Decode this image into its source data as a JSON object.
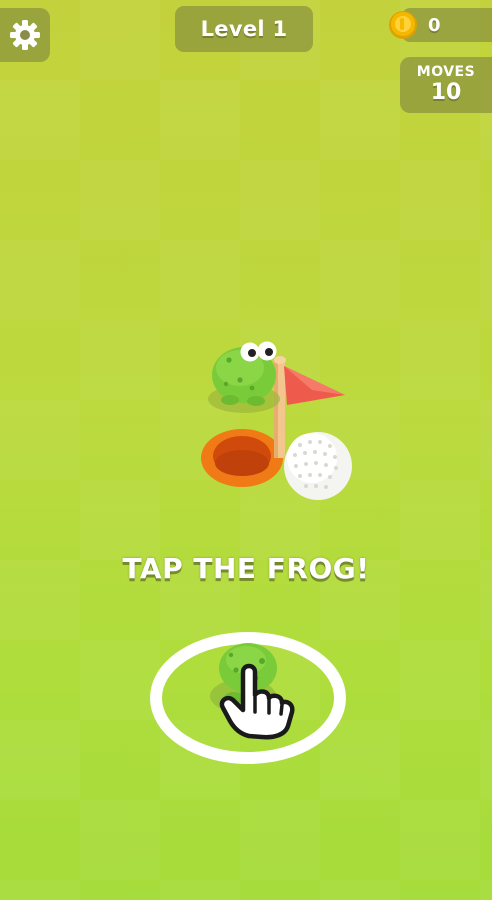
{
  "hud": {
    "level_label": "Level 1",
    "coins": "0",
    "moves_label": "MOVES",
    "moves_value": "10"
  },
  "tutorial": {
    "prompt": "TAP THE FROG!"
  },
  "icons": {
    "settings": "gear-icon",
    "coin": "coin-icon",
    "pointer": "hand-pointer-icon"
  },
  "colors": {
    "background_top": "#c3d23c",
    "background_bottom": "#a6dc3b",
    "frog_green": "#7acb3a",
    "flag_red": "#ee5a4c",
    "hole_orange": "#f07a16",
    "ball_white": "#f4f4f0",
    "coin_gold": "#f5b800",
    "target_ring": "#ffffff"
  }
}
